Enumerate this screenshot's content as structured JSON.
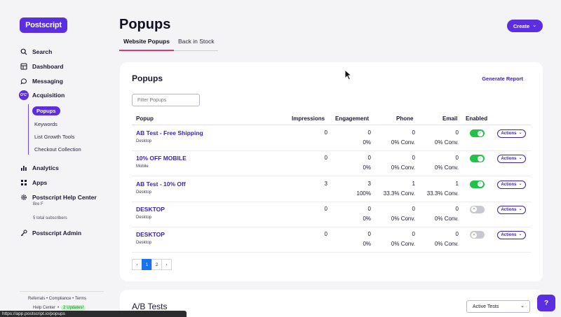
{
  "logo": "Postscript",
  "nav": {
    "search": "Search",
    "dashboard": "Dashboard",
    "messaging": "Messaging",
    "acquisition": "Acquisition",
    "acquisition_icon": "O'C'",
    "sub": [
      "Popups",
      "Keywords",
      "List Growth Tools",
      "Checkout Collection"
    ],
    "analytics": "Analytics",
    "apps": "Apps",
    "help_center": "Postscript Help Center",
    "user": "Bre F",
    "subscribers": "5 total subscribers",
    "admin": "Postscript Admin"
  },
  "footer": {
    "referrals": "Referrals",
    "compliance": "Compliance",
    "terms": "Terms",
    "help_center": "Help Center",
    "updates": "2 Updates!",
    "sep": "•"
  },
  "header": {
    "title": "Popups",
    "tabs": [
      "Website Popups",
      "Back in Stock"
    ],
    "create_label": "Create",
    "create_caret": "⌄"
  },
  "popups_card": {
    "title": "Popups",
    "generate_report": "Generate Report",
    "filter_placeholder": "Filter Popups",
    "columns": [
      "Popup",
      "Impressions",
      "Engagement",
      "Phone",
      "Email",
      "Enabled"
    ],
    "rows": [
      {
        "name": "AB Test - Free Shipping",
        "device": "Desktop",
        "impressions": "0",
        "engagement": "0",
        "engagement_pct": "0%",
        "phone": "0",
        "phone_conv": "0% Conv.",
        "email": "0",
        "email_conv": "0% Conv.",
        "enabled": true
      },
      {
        "name": "10% OFF MOBILE",
        "device": "Mobile",
        "impressions": "0",
        "engagement": "0",
        "engagement_pct": "0%",
        "phone": "0",
        "phone_conv": "0% Conv.",
        "email": "0",
        "email_conv": "0% Conv.",
        "enabled": true
      },
      {
        "name": "AB Test - 10% Off",
        "device": "Desktop",
        "impressions": "3",
        "engagement": "3",
        "engagement_pct": "100%",
        "phone": "1",
        "phone_conv": "33.3% Conv.",
        "email": "1",
        "email_conv": "33.3% Conv.",
        "enabled": true
      },
      {
        "name": "DESKTOP",
        "device": "Desktop",
        "impressions": "0",
        "engagement": "0",
        "engagement_pct": "0%",
        "phone": "0",
        "phone_conv": "0% Conv.",
        "email": "0",
        "email_conv": "0% Conv.",
        "enabled": false
      },
      {
        "name": "DESKTOP",
        "device": "Desktop",
        "impressions": "0",
        "engagement": "0",
        "engagement_pct": "0%",
        "phone": "0",
        "phone_conv": "0% Conv.",
        "email": "0",
        "email_conv": "0% Conv.",
        "enabled": false
      }
    ],
    "actions_label": "Actions",
    "actions_caret": "⌄",
    "pagination": {
      "prev": "‹",
      "pages": [
        "1",
        "2"
      ],
      "next": "›",
      "current": "1"
    }
  },
  "ab_card": {
    "title": "A/B Tests",
    "select_value": "Active Tests",
    "select_caret": "⌄"
  },
  "help_button": "?",
  "status_url": "https://app.postscript.io/popups",
  "colors": {
    "brand": "#5b2ee0",
    "link": "#3a1eb8",
    "toggle_on": "#22c24a",
    "tab_underline": "#e0337a"
  }
}
